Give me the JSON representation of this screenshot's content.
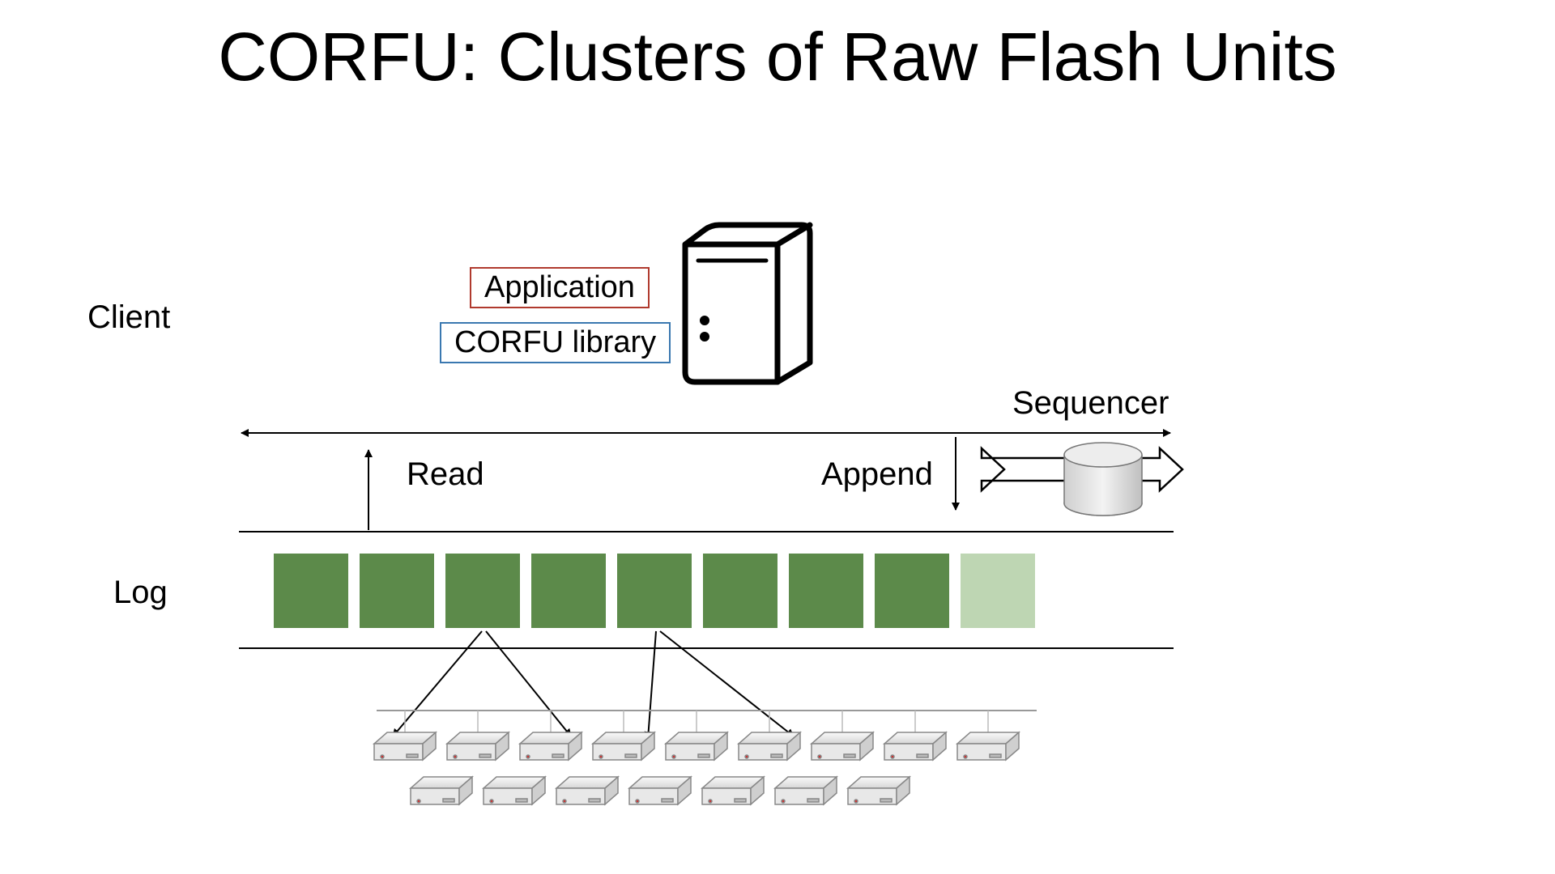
{
  "title": "CORFU: Clusters of Raw Flash Units",
  "labels": {
    "client": "Client",
    "application": "Application",
    "corfu_library": "CORFU library",
    "sequencer": "Sequencer",
    "read": "Read",
    "append": "Append",
    "log": "Log"
  },
  "colors": {
    "application_box_border": "#b03a2e",
    "library_box_border": "#3a78b0",
    "log_block": "#5c8a4a",
    "log_block_light": "#a8c89a"
  },
  "log_blocks": {
    "filled": 8,
    "pending": 1
  }
}
